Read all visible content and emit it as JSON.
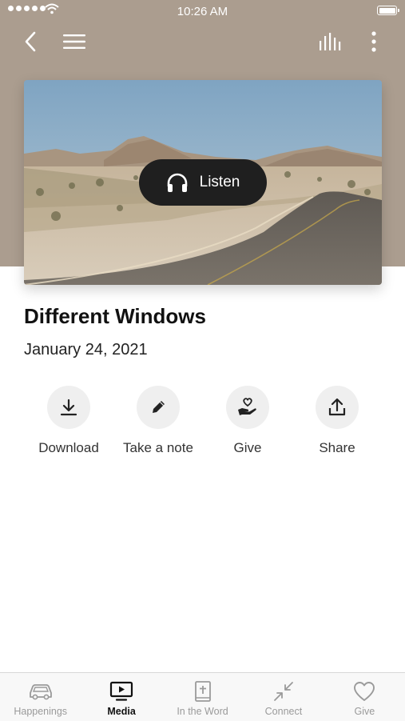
{
  "status_bar": {
    "time": "10:26 AM"
  },
  "header": {
    "back_icon": "chevron-left-icon",
    "menu_icon": "hamburger-menu-icon",
    "audio_icon": "audio-bars-icon",
    "more_icon": "vertical-dots-icon"
  },
  "hero": {
    "listen_label": "Listen",
    "listen_icon": "headphones-icon"
  },
  "sermon": {
    "title": "Different Windows",
    "date": "January 24, 2021"
  },
  "actions": [
    {
      "label": "Download",
      "icon": "download-icon"
    },
    {
      "label": "Take a note",
      "icon": "pencil-icon"
    },
    {
      "label": "Give",
      "icon": "hand-heart-icon"
    },
    {
      "label": "Share",
      "icon": "share-icon"
    }
  ],
  "tabbar": {
    "active": "Media",
    "tabs": [
      {
        "label": "Happenings",
        "icon": "car-icon"
      },
      {
        "label": "Media",
        "icon": "tv-play-icon"
      },
      {
        "label": "In the Word",
        "icon": "bible-icon"
      },
      {
        "label": "Connect",
        "icon": "arrows-collapse-icon"
      },
      {
        "label": "Give",
        "icon": "heart-icon"
      }
    ]
  },
  "colors": {
    "header_bg": "#ab9d8f",
    "listen_bg": "#1f1f1f",
    "action_circle": "#efefef",
    "tab_active": "#111111",
    "tab_inactive": "#9a9a9a"
  }
}
